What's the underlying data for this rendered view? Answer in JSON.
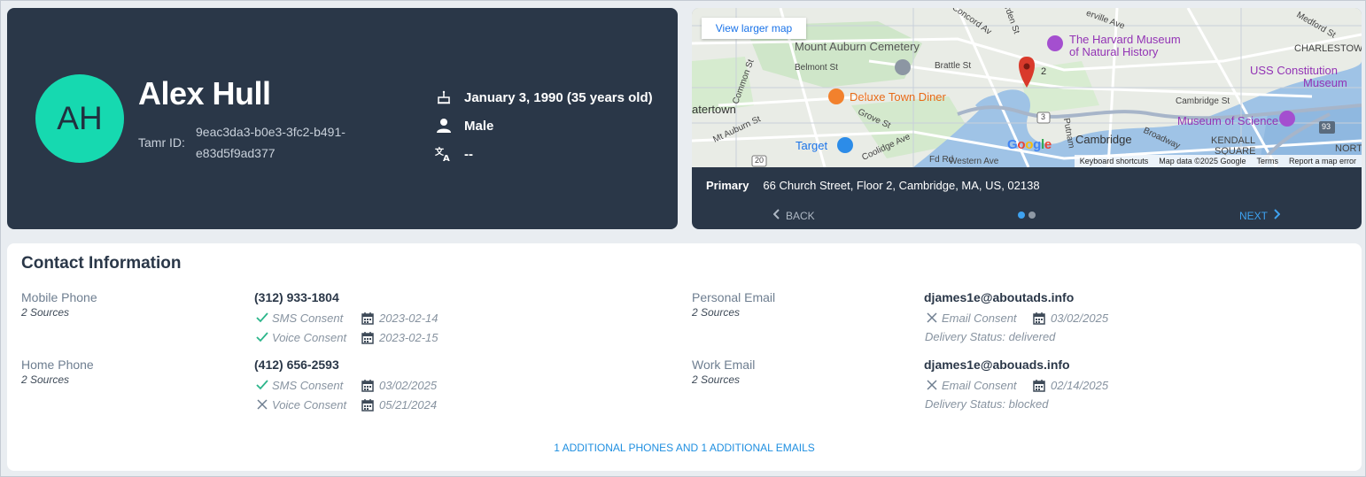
{
  "profile": {
    "initials": "AH",
    "name": "Alex Hull",
    "tamr_label": "Tamr ID:",
    "tamr_id": "9eac3da3-b0e3-3fc2-b491-e83d5f9ad377",
    "birthdate": "January 3, 1990 (35 years old)",
    "gender": "Male",
    "language": "--"
  },
  "map": {
    "larger_map": "View larger map",
    "labels": {
      "mount_auburn": "Mount Auburn Cemetery",
      "harvard_museum_1": "The Harvard Museum",
      "harvard_museum_2": "of Natural History",
      "uss_1": "USS Constitution",
      "uss_2": "Museum",
      "charlestown": "CHARLESTOWN",
      "deluxe": "Deluxe Town Diner",
      "watertown": "atertown",
      "museum_science": "Museum of Science",
      "target": "Target",
      "cambridge": "Cambridge",
      "kendall_1": "KENDALL",
      "kendall_2": "SQUARE",
      "north": "NORT",
      "marker_count": "2",
      "belmont": "Belmont St",
      "brattle": "Brattle St",
      "concord": "Concord Av",
      "garden": "Garden St",
      "medford": "Medford St",
      "erville": "erville Ave",
      "common": "Common St",
      "mt_auburn": "Mt Auburn St",
      "grove": "Grove St",
      "coolidge": "Coolidge Ave",
      "fd": "Fd Rd",
      "western": "Western Ave",
      "cambridge_st": "Cambridge St",
      "putnam": "Putnam",
      "broadway": "Broadway",
      "route3": "3",
      "route20": "20",
      "route93": "93"
    },
    "google": "Google",
    "footer": [
      "Keyboard shortcuts",
      "Map data ©2025 Google",
      "Terms",
      "Report a map error"
    ]
  },
  "address": {
    "label": "Primary",
    "value": "66 Church Street, Floor 2, Cambridge, MA, US, 02138",
    "back": "BACK",
    "next": "NEXT"
  },
  "contact": {
    "title": "Contact Information",
    "mobile": {
      "label": "Mobile Phone",
      "sources": "2 Sources",
      "value": "(312) 933-1804",
      "sms": {
        "label": "SMS Consent",
        "date": "2023-02-14",
        "granted": true
      },
      "voice": {
        "label": "Voice Consent",
        "date": "2023-02-15",
        "granted": true
      }
    },
    "home": {
      "label": "Home Phone",
      "sources": "2 Sources",
      "value": "(412) 656-2593",
      "sms": {
        "label": "SMS Consent",
        "date": "03/02/2025",
        "granted": true
      },
      "voice": {
        "label": "Voice Consent",
        "date": "05/21/2024",
        "granted": false
      }
    },
    "personal_email": {
      "label": "Personal Email",
      "sources": "2 Sources",
      "value": "djames1e@aboutads.info",
      "consent": {
        "label": "Email Consent",
        "date": "03/02/2025",
        "granted": false
      },
      "delivery": "Delivery Status: delivered"
    },
    "work_email": {
      "label": "Work Email",
      "sources": "2 Sources",
      "value": "djames1e@abouads.info",
      "consent": {
        "label": "Email Consent",
        "date": "02/14/2025",
        "granted": false
      },
      "delivery": "Delivery Status: blocked"
    },
    "more": "1 ADDITIONAL PHONES AND 1 ADDITIONAL EMAILS"
  },
  "colors": {
    "card_dark": "#2a3748",
    "avatar": "#16d9b0",
    "check": "#2bb58a",
    "link": "#1f8fe0"
  }
}
